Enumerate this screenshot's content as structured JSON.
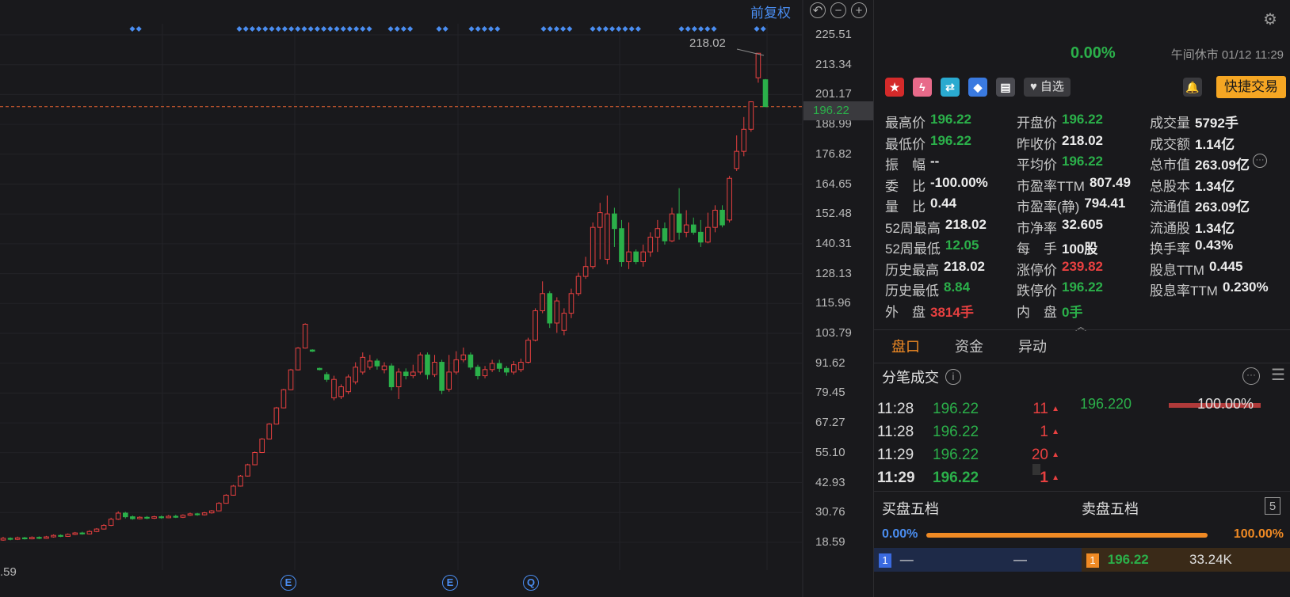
{
  "chart": {
    "fuquan_label": "前复权",
    "y_ticks": [
      "225.51",
      "213.34",
      "201.17",
      "188.99",
      "176.82",
      "164.65",
      "152.48",
      "140.31",
      "128.13",
      "115.96",
      "103.79",
      "91.62",
      "79.45",
      "67.27",
      "55.10",
      "42.93",
      "30.76",
      "18.59"
    ],
    "current_price_tag": "196.22",
    "peak_label": "218.02",
    "low_label": ".59",
    "event_markers": [
      "E",
      "E",
      "Q"
    ],
    "tool_icons": [
      "undo-icon",
      "zoom-out-icon",
      "zoom-in-icon"
    ],
    "colors": {
      "up": "#e84040",
      "down": "#2bb04a",
      "marker": "#4a8df0",
      "current_line": "#e06030"
    }
  },
  "chart_data": {
    "type": "candlestick",
    "ylim": [
      18.59,
      225.51
    ],
    "series": [
      {
        "o": 19.5,
        "c": 20.2,
        "h": 20.8,
        "l": 19.2
      },
      {
        "o": 20.2,
        "c": 19.8,
        "h": 20.6,
        "l": 19.4
      },
      {
        "o": 19.8,
        "c": 20.4,
        "h": 20.9,
        "l": 19.5
      },
      {
        "o": 20.4,
        "c": 20.0,
        "h": 20.8,
        "l": 19.7
      },
      {
        "o": 20.0,
        "c": 20.6,
        "h": 21.0,
        "l": 19.8
      },
      {
        "o": 20.6,
        "c": 20.2,
        "h": 21.0,
        "l": 19.9
      },
      {
        "o": 20.2,
        "c": 20.8,
        "h": 21.2,
        "l": 20.0
      },
      {
        "o": 20.8,
        "c": 21.4,
        "h": 21.8,
        "l": 20.5
      },
      {
        "o": 21.4,
        "c": 21.0,
        "h": 21.8,
        "l": 20.7
      },
      {
        "o": 21.0,
        "c": 21.8,
        "h": 22.2,
        "l": 20.8
      },
      {
        "o": 21.8,
        "c": 22.4,
        "h": 22.8,
        "l": 21.5
      },
      {
        "o": 22.4,
        "c": 22.0,
        "h": 22.9,
        "l": 21.7
      },
      {
        "o": 22.0,
        "c": 23.0,
        "h": 23.5,
        "l": 21.8
      },
      {
        "o": 23.0,
        "c": 24.0,
        "h": 24.4,
        "l": 22.7
      },
      {
        "o": 24.0,
        "c": 25.5,
        "h": 26.0,
        "l": 23.8
      },
      {
        "o": 25.5,
        "c": 28.0,
        "h": 28.6,
        "l": 25.2
      },
      {
        "o": 28.0,
        "c": 30.5,
        "h": 31.2,
        "l": 27.7
      },
      {
        "o": 30.5,
        "c": 29.0,
        "h": 31.0,
        "l": 28.3
      },
      {
        "o": 29.0,
        "c": 28.2,
        "h": 29.5,
        "l": 27.8
      },
      {
        "o": 28.2,
        "c": 28.8,
        "h": 29.2,
        "l": 27.9
      },
      {
        "o": 28.8,
        "c": 28.4,
        "h": 29.3,
        "l": 28.0
      },
      {
        "o": 28.4,
        "c": 29.0,
        "h": 29.4,
        "l": 28.1
      },
      {
        "o": 29.0,
        "c": 28.6,
        "h": 29.5,
        "l": 28.2
      },
      {
        "o": 28.6,
        "c": 29.2,
        "h": 29.7,
        "l": 28.4
      },
      {
        "o": 29.2,
        "c": 28.8,
        "h": 29.8,
        "l": 28.5
      },
      {
        "o": 28.8,
        "c": 29.6,
        "h": 30.0,
        "l": 28.5
      },
      {
        "o": 29.6,
        "c": 30.2,
        "h": 30.7,
        "l": 29.3
      },
      {
        "o": 30.2,
        "c": 29.8,
        "h": 30.6,
        "l": 29.4
      },
      {
        "o": 29.8,
        "c": 30.6,
        "h": 31.0,
        "l": 29.5
      },
      {
        "o": 30.6,
        "c": 31.4,
        "h": 31.8,
        "l": 30.3
      },
      {
        "o": 31.4,
        "c": 34.5,
        "h": 35.0,
        "l": 31.2
      },
      {
        "o": 34.5,
        "c": 37.8,
        "h": 38.2,
        "l": 34.3
      },
      {
        "o": 37.8,
        "c": 41.5,
        "h": 42.0,
        "l": 37.6
      },
      {
        "o": 41.5,
        "c": 45.6,
        "h": 46.0,
        "l": 41.3
      },
      {
        "o": 45.6,
        "c": 50.2,
        "h": 50.6,
        "l": 45.4
      },
      {
        "o": 50.2,
        "c": 55.2,
        "h": 55.6,
        "l": 50.0
      },
      {
        "o": 55.2,
        "c": 60.7,
        "h": 61.1,
        "l": 55.0
      },
      {
        "o": 60.7,
        "c": 66.8,
        "h": 67.2,
        "l": 60.5
      },
      {
        "o": 66.8,
        "c": 73.4,
        "h": 73.8,
        "l": 66.6
      },
      {
        "o": 73.4,
        "c": 80.8,
        "h": 81.2,
        "l": 73.2
      },
      {
        "o": 80.8,
        "c": 88.9,
        "h": 89.3,
        "l": 80.6
      },
      {
        "o": 88.9,
        "c": 97.8,
        "h": 98.2,
        "l": 88.7
      },
      {
        "o": 97.8,
        "c": 107.5,
        "h": 107.9,
        "l": 97.6
      },
      {
        "o": 97.0,
        "c": 96.5,
        "h": 97.3,
        "l": 96.2
      },
      {
        "o": 89.5,
        "c": 89.0,
        "h": 89.8,
        "l": 88.7
      },
      {
        "o": 87.0,
        "c": 85.0,
        "h": 88.0,
        "l": 84.0
      },
      {
        "o": 77.5,
        "c": 85.0,
        "h": 86.5,
        "l": 76.5
      },
      {
        "o": 78.0,
        "c": 82.0,
        "h": 83.0,
        "l": 77.0
      },
      {
        "o": 80.0,
        "c": 86.0,
        "h": 87.0,
        "l": 79.0
      },
      {
        "o": 84.0,
        "c": 90.0,
        "h": 92.0,
        "l": 83.0
      },
      {
        "o": 88.0,
        "c": 94.0,
        "h": 96.0,
        "l": 87.0
      },
      {
        "o": 90.0,
        "c": 92.5,
        "h": 95.0,
        "l": 89.0
      },
      {
        "o": 92.5,
        "c": 90.5,
        "h": 93.5,
        "l": 89.0
      },
      {
        "o": 89.0,
        "c": 90.5,
        "h": 92.0,
        "l": 87.5
      },
      {
        "o": 90.5,
        "c": 82.0,
        "h": 91.5,
        "l": 80.5
      },
      {
        "o": 82.0,
        "c": 88.0,
        "h": 89.5,
        "l": 77.0
      },
      {
        "o": 88.0,
        "c": 86.5,
        "h": 89.5,
        "l": 85.0
      },
      {
        "o": 86.5,
        "c": 88.0,
        "h": 91.0,
        "l": 85.5
      },
      {
        "o": 88.0,
        "c": 95.0,
        "h": 96.0,
        "l": 87.0
      },
      {
        "o": 95.0,
        "c": 87.0,
        "h": 96.0,
        "l": 85.0
      },
      {
        "o": 87.0,
        "c": 92.0,
        "h": 95.0,
        "l": 86.0
      },
      {
        "o": 92.0,
        "c": 80.5,
        "h": 93.0,
        "l": 79.0
      },
      {
        "o": 81.0,
        "c": 88.0,
        "h": 95.0,
        "l": 80.0
      },
      {
        "o": 88.0,
        "c": 93.0,
        "h": 96.5,
        "l": 87.0
      },
      {
        "o": 93.0,
        "c": 95.0,
        "h": 98.0,
        "l": 92.0
      },
      {
        "o": 95.0,
        "c": 90.0,
        "h": 96.0,
        "l": 89.0
      },
      {
        "o": 90.0,
        "c": 86.5,
        "h": 91.0,
        "l": 85.0
      },
      {
        "o": 86.5,
        "c": 89.0,
        "h": 90.5,
        "l": 85.5
      },
      {
        "o": 89.0,
        "c": 91.5,
        "h": 93.0,
        "l": 88.0
      },
      {
        "o": 91.5,
        "c": 89.5,
        "h": 93.0,
        "l": 88.0
      },
      {
        "o": 89.5,
        "c": 88.0,
        "h": 90.5,
        "l": 86.5
      },
      {
        "o": 88.0,
        "c": 91.0,
        "h": 92.5,
        "l": 87.0
      },
      {
        "o": 89.0,
        "c": 92.0,
        "h": 93.5,
        "l": 88.0
      },
      {
        "o": 92.0,
        "c": 101.0,
        "h": 102.0,
        "l": 91.5
      },
      {
        "o": 101.0,
        "c": 113.0,
        "h": 114.0,
        "l": 100.5
      },
      {
        "o": 113.0,
        "c": 120.0,
        "h": 125.0,
        "l": 112.0
      },
      {
        "o": 120.0,
        "c": 108.0,
        "h": 121.0,
        "l": 106.0
      },
      {
        "o": 108.0,
        "c": 117.0,
        "h": 118.5,
        "l": 104.0
      },
      {
        "o": 105.0,
        "c": 112.0,
        "h": 114.0,
        "l": 103.0
      },
      {
        "o": 112.0,
        "c": 120.0,
        "h": 122.0,
        "l": 110.0
      },
      {
        "o": 120.0,
        "c": 127.0,
        "h": 128.5,
        "l": 119.0
      },
      {
        "o": 127.0,
        "c": 131.0,
        "h": 135.0,
        "l": 126.0
      },
      {
        "o": 131.0,
        "c": 147.0,
        "h": 149.0,
        "l": 130.0
      },
      {
        "o": 147.0,
        "c": 153.0,
        "h": 157.0,
        "l": 134.0
      },
      {
        "o": 134.0,
        "c": 152.5,
        "h": 160.0,
        "l": 132.0
      },
      {
        "o": 152.5,
        "c": 146.5,
        "h": 155.0,
        "l": 139.0
      },
      {
        "o": 146.5,
        "c": 133.0,
        "h": 150.0,
        "l": 131.0
      },
      {
        "o": 133.0,
        "c": 137.0,
        "h": 149.0,
        "l": 130.0
      },
      {
        "o": 137.0,
        "c": 133.0,
        "h": 138.0,
        "l": 132.0
      },
      {
        "o": 133.0,
        "c": 137.0,
        "h": 140.0,
        "l": 131.0
      },
      {
        "o": 137.0,
        "c": 143.0,
        "h": 145.0,
        "l": 135.0
      },
      {
        "o": 143.0,
        "c": 146.5,
        "h": 150.0,
        "l": 137.0
      },
      {
        "o": 146.5,
        "c": 141.5,
        "h": 149.0,
        "l": 140.0
      },
      {
        "o": 141.5,
        "c": 152.5,
        "h": 155.0,
        "l": 141.0
      },
      {
        "o": 152.5,
        "c": 145.0,
        "h": 163.0,
        "l": 142.0
      },
      {
        "o": 145.0,
        "c": 148.0,
        "h": 154.0,
        "l": 143.0
      },
      {
        "o": 148.0,
        "c": 145.0,
        "h": 151.0,
        "l": 144.0
      },
      {
        "o": 145.0,
        "c": 141.0,
        "h": 150.0,
        "l": 139.0
      },
      {
        "o": 141.0,
        "c": 147.0,
        "h": 153.0,
        "l": 140.5
      },
      {
        "o": 147.0,
        "c": 154.0,
        "h": 156.0,
        "l": 145.0
      },
      {
        "o": 154.0,
        "c": 148.0,
        "h": 156.0,
        "l": 147.0
      },
      {
        "o": 150.0,
        "c": 167.0,
        "h": 168.0,
        "l": 149.0
      },
      {
        "o": 171.0,
        "c": 178.0,
        "h": 184.5,
        "l": 170.0
      },
      {
        "o": 178.0,
        "c": 187.0,
        "h": 192.0,
        "l": 176.0
      },
      {
        "o": 187.0,
        "c": 198.2,
        "h": 198.4,
        "l": 186.0
      },
      {
        "o": 208.0,
        "c": 218.0,
        "h": 218.02,
        "l": 206.0
      },
      {
        "o": 207.2,
        "c": 196.22,
        "h": 207.5,
        "l": 196.22
      }
    ]
  },
  "quote": {
    "change_pct": "0.00%",
    "status": "午间休市 01/12 11:29",
    "watch_label": "自选",
    "quick_trade_label": "快捷交易",
    "stats": [
      [
        {
          "label": "最高价",
          "value": "196.22",
          "color": "green"
        },
        {
          "label": "开盘价",
          "value": "196.22",
          "color": "green"
        },
        {
          "label": "成交量",
          "value": "5792手",
          "color": "white"
        }
      ],
      [
        {
          "label": "最低价",
          "value": "196.22",
          "color": "green"
        },
        {
          "label": "昨收价",
          "value": "218.02",
          "color": "white"
        },
        {
          "label": "成交额",
          "value": "1.14亿",
          "color": "white"
        }
      ],
      [
        {
          "label": "振　幅",
          "value": "--",
          "color": "white"
        },
        {
          "label": "平均价",
          "value": "196.22",
          "color": "green"
        },
        {
          "label": "总市值",
          "value": "263.09亿",
          "color": "white"
        }
      ],
      [
        {
          "label": "委　比",
          "value": "-100.00%",
          "color": "white"
        },
        {
          "label": "市盈率TTM",
          "value": "807.49",
          "color": "white"
        },
        {
          "label": "总股本",
          "value": "1.34亿",
          "color": "white"
        }
      ],
      [
        {
          "label": "量　比",
          "value": "0.44",
          "color": "white"
        },
        {
          "label": "市盈率(静)",
          "value": "794.41",
          "color": "white"
        },
        {
          "label": "流通值",
          "value": "263.09亿",
          "color": "white"
        }
      ],
      [
        {
          "label": "52周最高",
          "value": "218.02",
          "color": "white"
        },
        {
          "label": "市净率",
          "value": "32.605",
          "color": "white"
        },
        {
          "label": "流通股",
          "value": "1.34亿",
          "color": "white"
        }
      ],
      [
        {
          "label": "52周最低",
          "value": "12.05",
          "color": "green"
        },
        {
          "label": "每　手",
          "value": "100股",
          "color": "white"
        },
        {
          "label": "换手率",
          "value": "0.43%",
          "color": "white"
        }
      ],
      [
        {
          "label": "历史最高",
          "value": "218.02",
          "color": "white"
        },
        {
          "label": "涨停价",
          "value": "239.82",
          "color": "red"
        },
        {
          "label": "股息TTM",
          "value": "0.445",
          "color": "white"
        }
      ],
      [
        {
          "label": "历史最低",
          "value": "8.84",
          "color": "green"
        },
        {
          "label": "跌停价",
          "value": "196.22",
          "color": "green"
        },
        {
          "label": "股息率TTM",
          "value": "0.230%",
          "color": "white"
        }
      ],
      [
        {
          "label": "外　盘",
          "value": "3814手",
          "color": "red"
        },
        {
          "label": "内　盘",
          "value": "0手",
          "color": "green"
        }
      ]
    ]
  },
  "tabs": [
    "盘口",
    "资金",
    "异动"
  ],
  "ticks": {
    "title": "分笔成交",
    "rows": [
      {
        "time": "11:28",
        "price": "196.22",
        "vol": "11"
      },
      {
        "time": "11:28",
        "price": "196.22",
        "vol": "1"
      },
      {
        "time": "11:29",
        "price": "196.22",
        "vol": "20"
      },
      {
        "time": "11:29",
        "price": "196.22",
        "vol": "1"
      }
    ],
    "dist_price": "196.220",
    "dist_pct": "100.00%"
  },
  "book": {
    "bid_title": "买盘五档",
    "ask_title": "卖盘五档",
    "levels_btn": "5",
    "bid_ratio": "0.00%",
    "ask_ratio": "100.00%",
    "bid1_level": "1",
    "bid1_price": "—",
    "bid1_vol": "—",
    "ask1_level": "1",
    "ask1_price": "196.22",
    "ask1_vol": "33.24K"
  }
}
